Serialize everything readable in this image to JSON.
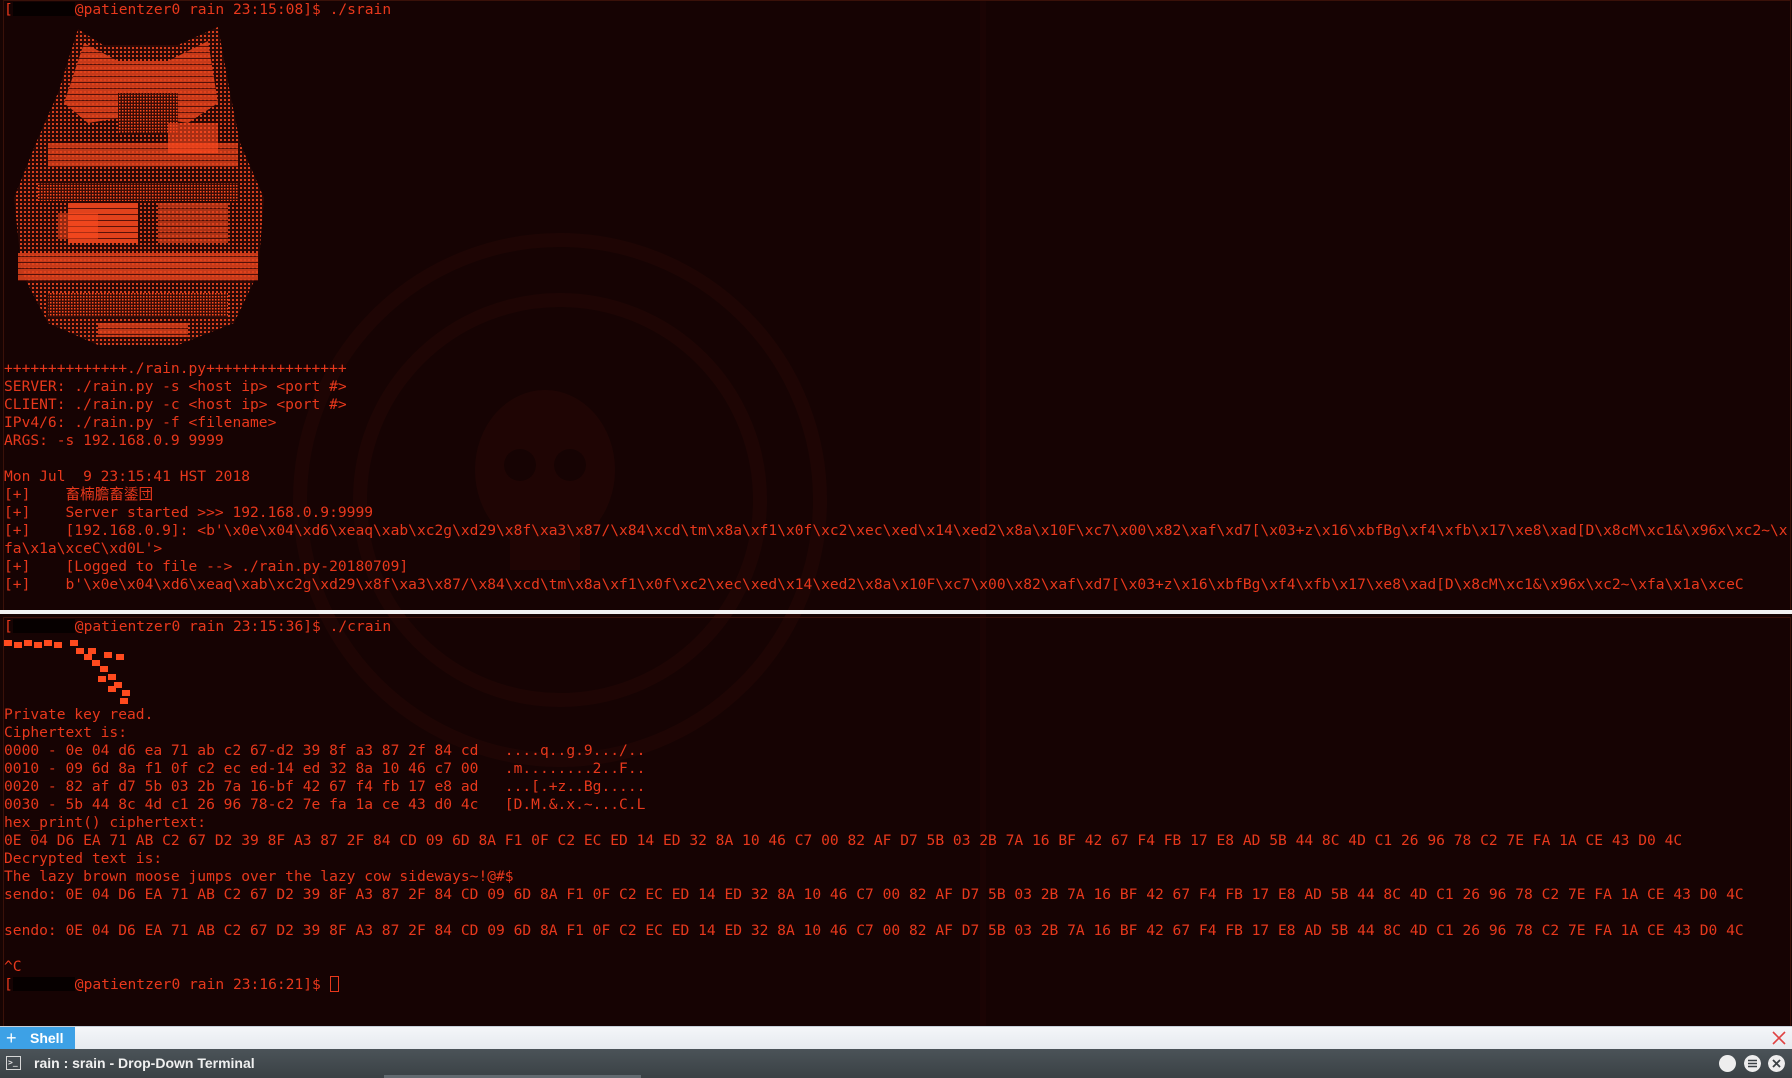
{
  "colors": {
    "terminal_text": "#e8381c",
    "background": "#170403",
    "tab_accent": "#3da1e6"
  },
  "top_pane": {
    "lines": [
      {
        "text": "@patientzer0 rain 23:15:08]$ ./srain",
        "prompt_open": "[",
        "redacted": true
      },
      {
        "text": "++++++++++++++./rain.py++++++++++++++++"
      },
      {
        "text": "SERVER: ./rain.py -s <host ip> <port #>"
      },
      {
        "text": "CLIENT: ./rain.py -c <host ip> <port #>"
      },
      {
        "text": "IPv4/6: ./rain.py -f <filename>"
      },
      {
        "text": "ARGS: -s 192.168.0.9 9999"
      },
      {
        "text": ""
      },
      {
        "text": "Mon Jul  9 23:15:41 HST 2018"
      },
      {
        "text": "[+]    畜楠膽畜鋈団"
      },
      {
        "text": "[+]    Server started >>> 192.168.0.9:9999"
      },
      {
        "text": "[+]    [192.168.0.9]: <b'\\x0e\\x04\\xd6\\xeaq\\xab\\xc2g\\xd29\\x8f\\xa3\\x87/\\x84\\xcd\\tm\\x8a\\xf1\\x0f\\xc2\\xec\\xed\\x14\\xed2\\x8a\\x10F\\xc7\\x00\\x82\\xaf\\xd7[\\x03+z\\x16\\xbfBg\\xf4\\xfb\\x17\\xe8\\xad[D\\x8cM\\xc1&\\x96x\\xc2~\\xfa\\x1a\\xceC\\xd0L'>"
      },
      {
        "text": "[+]    [Logged to file --> ./rain.py-20180709]"
      },
      {
        "text": "[+]    b'\\x0e\\x04\\xd6\\xeaq\\xab\\xc2g\\xd29\\x8f\\xa3\\x87/\\x84\\xcd\\tm\\x8a\\xf1\\x0f\\xc2\\xec\\xed\\x14\\xed2\\x8a\\x10F\\xc7\\x00\\x82\\xaf\\xd7[\\x03+z\\x16\\xbfBg\\xf4\\xfb\\x17\\xe8\\xad[D\\x8cM\\xc1&\\x96x\\xc2~\\xfa\\x1a\\xceC"
      }
    ]
  },
  "bottom_pane": {
    "lines": [
      {
        "text": "@patientzer0 rain 23:15:36]$ ./crain",
        "prompt_open": "[",
        "redacted": true
      },
      {
        "text": "Private key read."
      },
      {
        "text": "Ciphertext is:"
      },
      {
        "text": "0000 - 0e 04 d6 ea 71 ab c2 67-d2 39 8f a3 87 2f 84 cd   ....q..g.9.../.."
      },
      {
        "text": "0010 - 09 6d 8a f1 0f c2 ec ed-14 ed 32 8a 10 46 c7 00   .m........2..F.."
      },
      {
        "text": "0020 - 82 af d7 5b 03 2b 7a 16-bf 42 67 f4 fb 17 e8 ad   ...[.+z..Bg....."
      },
      {
        "text": "0030 - 5b 44 8c 4d c1 26 96 78-c2 7e fa 1a ce 43 d0 4c   [D.M.&.x.~...C.L"
      },
      {
        "text": "hex_print() ciphertext:"
      },
      {
        "text": "0E 04 D6 EA 71 AB C2 67 D2 39 8F A3 87 2F 84 CD 09 6D 8A F1 0F C2 EC ED 14 ED 32 8A 10 46 C7 00 82 AF D7 5B 03 2B 7A 16 BF 42 67 F4 FB 17 E8 AD 5B 44 8C 4D C1 26 96 78 C2 7E FA 1A CE 43 D0 4C"
      },
      {
        "text": "Decrypted text is:"
      },
      {
        "text": "The lazy brown moose jumps over the lazy cow sideways~!@#$"
      },
      {
        "text": "sendo: 0E 04 D6 EA 71 AB C2 67 D2 39 8F A3 87 2F 84 CD 09 6D 8A F1 0F C2 EC ED 14 ED 32 8A 10 46 C7 00 82 AF D7 5B 03 2B 7A 16 BF 42 67 F4 FB 17 E8 AD 5B 44 8C 4D C1 26 96 78 C2 7E FA 1A CE 43 D0 4C"
      },
      {
        "text": ""
      },
      {
        "text": "sendo: 0E 04 D6 EA 71 AB C2 67 D2 39 8F A3 87 2F 84 CD 09 6D 8A F1 0F C2 EC ED 14 ED 32 8A 10 46 C7 00 82 AF D7 5B 03 2B 7A 16 BF 42 67 F4 FB 17 E8 AD 5B 44 8C 4D C1 26 96 78 C2 7E FA 1A CE 43 D0 4C"
      },
      {
        "text": ""
      },
      {
        "text": "^C"
      },
      {
        "text": "@patientzer0 rain 23:16:21]$ ",
        "prompt_open": "[",
        "redacted": true
      }
    ]
  },
  "tab_bar": {
    "tab_label": "Shell",
    "add_icon": "plus-icon",
    "close_icon": "close-x-icon"
  },
  "status_bar": {
    "title": "rain : srain - Drop-Down Terminal",
    "icons": [
      "terminal-icon",
      "circle-icon",
      "menu-icon",
      "close-circle-icon"
    ]
  }
}
